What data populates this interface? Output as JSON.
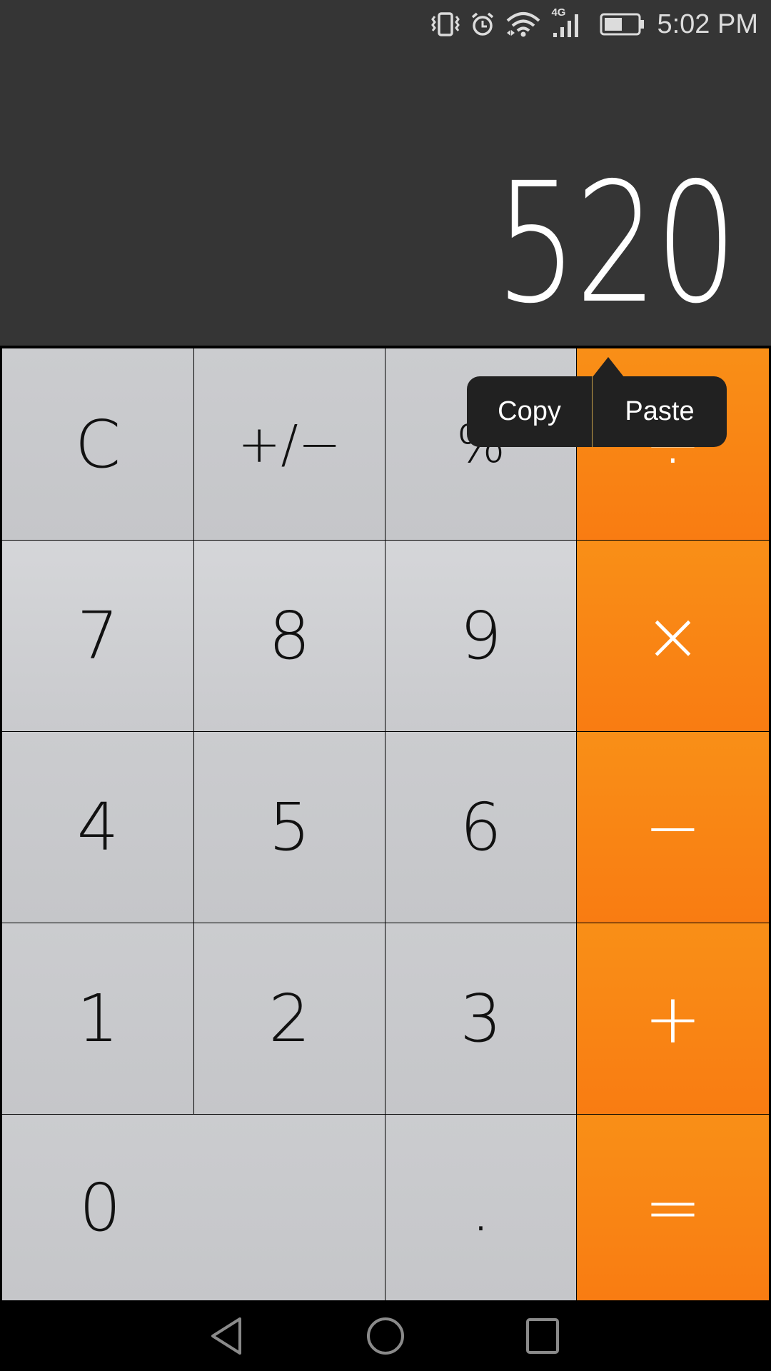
{
  "status_bar": {
    "icons": [
      "vibrate-icon",
      "alarm-icon",
      "wifi-icon",
      "signal-4g-icon",
      "battery-icon"
    ],
    "network_label": "4G",
    "battery_level": 0.5,
    "time": "5:02 PM"
  },
  "display": {
    "value": "520"
  },
  "keys": {
    "clear": "C",
    "sign": "+/−",
    "percent": "%",
    "divide": "÷",
    "seven": "7",
    "eight": "8",
    "nine": "9",
    "multiply": "×",
    "four": "4",
    "five": "5",
    "six": "6",
    "minus": "−",
    "one": "1",
    "two": "2",
    "three": "3",
    "plus": "+",
    "zero": "0",
    "decimal": ".",
    "equals": "="
  },
  "context_menu": {
    "copy": "Copy",
    "paste": "Paste"
  },
  "colors": {
    "accent": "#f98a15",
    "display_bg": "#353535",
    "key_gray": "#c8c9cc"
  },
  "nav_bar": {
    "icons": [
      "back-icon",
      "home-icon",
      "recents-icon"
    ]
  }
}
